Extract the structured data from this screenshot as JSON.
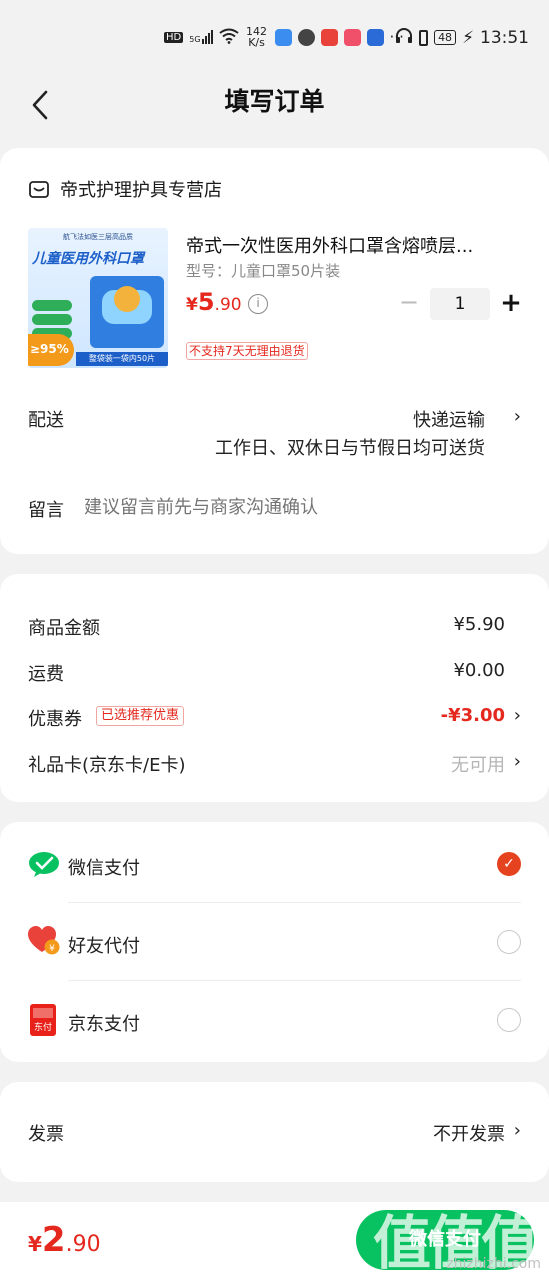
{
  "status_bar": {
    "network_speed_value": "142",
    "network_speed_unit": "K/s",
    "signal": "5G",
    "hd": "HD",
    "more": "···",
    "battery": "48",
    "time": "13:51"
  },
  "nav": {
    "title": "填写订单"
  },
  "order": {
    "shop_name": "帝式护理护具专营店",
    "product": {
      "name": "帝式一次性医用外科口罩含熔喷层...",
      "model": "型号：儿童口罩50片装",
      "price_currency": "¥",
      "price_int": "5",
      "price_dec": ".90",
      "quantity": "1",
      "return_notice": "不支持7天无理由退货",
      "image_text": {
        "top": "航飞法如医三层高品质",
        "title": "儿童医用外科口罩",
        "percent": "≥95%",
        "strip": "整袋装一袋内50片"
      }
    },
    "delivery_label": "配送",
    "delivery_value": "快递运输",
    "delivery_note": "工作日、双休日与节假日均可送货",
    "message_label": "留言",
    "message_placeholder": "建议留言前先与商家沟通确认"
  },
  "amounts": {
    "goods_label": "商品金额",
    "goods_value": "¥5.90",
    "shipping_label": "运费",
    "shipping_value": "¥0.00",
    "coupon_label": "优惠券",
    "coupon_badge": "已选推荐优惠",
    "coupon_value": "-¥3.00",
    "giftcard_label": "礼品卡(京东卡/E卡)",
    "giftcard_value": "无可用"
  },
  "payment": {
    "methods": [
      {
        "label": "微信支付",
        "icon": "wechat-pay-icon",
        "selected": true
      },
      {
        "label": "好友代付",
        "icon": "friend-pay-icon",
        "selected": false
      },
      {
        "label": "京东支付",
        "icon": "jd-pay-icon",
        "selected": false
      }
    ]
  },
  "invoice": {
    "label": "发票",
    "value": "不开发票"
  },
  "footer": {
    "total_currency": "¥",
    "total_int": "2",
    "total_dec": ".90",
    "pay_button": "微信支付"
  },
  "watermark": {
    "logo": "值值值",
    "url": "zhizhizhi.com"
  },
  "colors": {
    "accent_red": "#e5281e",
    "wechat_green": "#08c160",
    "radio_selected": "#e5431f"
  }
}
